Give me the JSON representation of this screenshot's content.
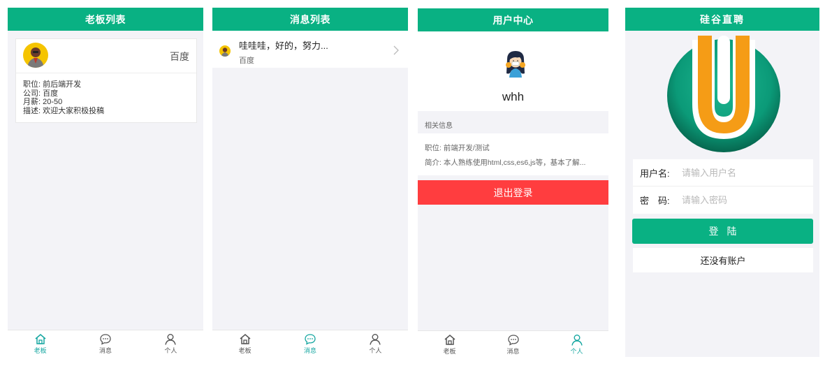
{
  "screen1": {
    "header": "老板列表",
    "card": {
      "company": "百度",
      "lines": [
        "职位: 前后端开发",
        "公司: 百度",
        "月薪: 20-50",
        "描述: 欢迎大家积极投稿"
      ]
    },
    "tabs": [
      "老板",
      "消息",
      "个人"
    ],
    "active_tab": 0
  },
  "screen2": {
    "header": "消息列表",
    "message": {
      "text": "哇哇哇，好的，努力...",
      "sub": "百度"
    },
    "tabs": [
      "老板",
      "消息",
      "个人"
    ],
    "active_tab": 1
  },
  "screen3": {
    "header": "用户中心",
    "username": "whh",
    "section_label": "相关信息",
    "info": [
      "职位: 前端开发/测试",
      "简介: 本人熟练使用html,css,es6,js等，基本了解..."
    ],
    "logout_label": "退出登录",
    "tabs": [
      "老板",
      "消息",
      "个人"
    ],
    "active_tab": 2
  },
  "screen4": {
    "header": "硅谷直聘",
    "username_label": "用户名:",
    "username_placeholder": "请输入用户名",
    "password_label": "密　码:",
    "password_placeholder": "请输入密码",
    "login_label": "登陆",
    "register_label": "还没有账户"
  },
  "colors": {
    "brand": "#09b183",
    "active_tab": "#14a6a0",
    "danger": "#ff3d3f",
    "background": "#f3f3f7"
  }
}
